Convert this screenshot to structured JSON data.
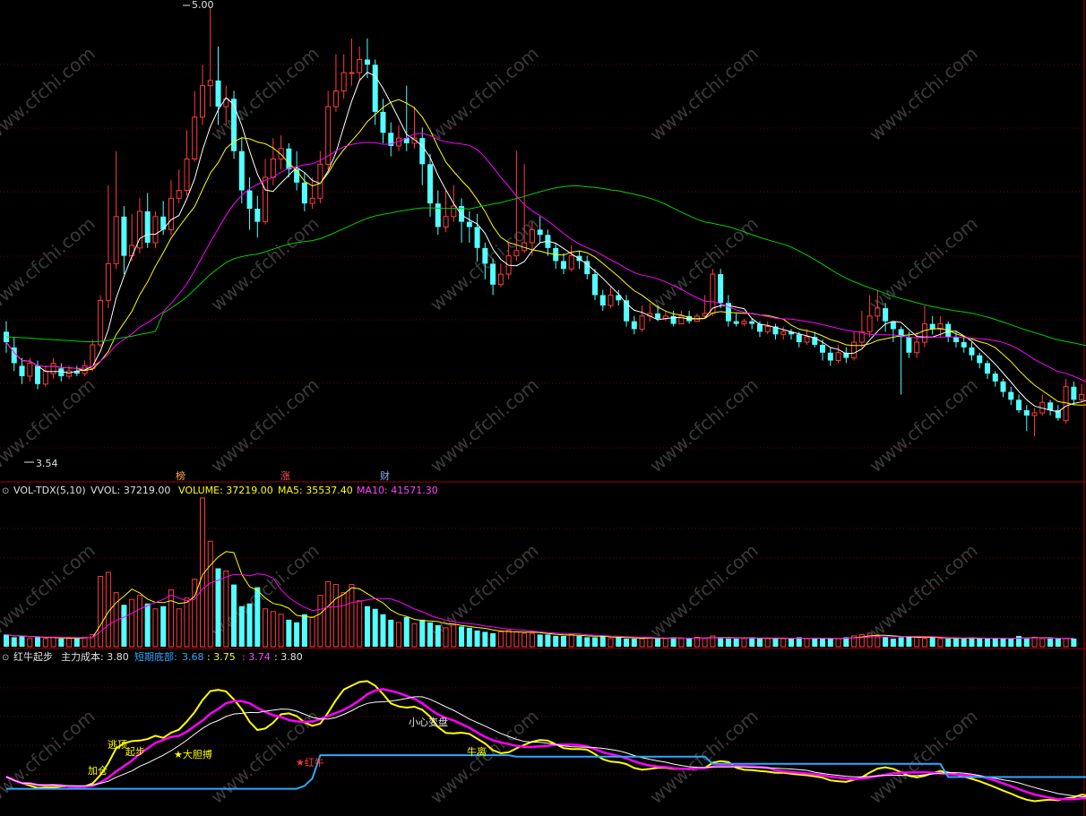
{
  "colors": {
    "bg": "#000000",
    "up": "#ff3b3b",
    "down": "#54ffff",
    "grid": "#7a0000",
    "sep": "#a00000",
    "ma_white": "#ffffff",
    "ma_yellow": "#ffff00",
    "ma_magenta": "#ff00ff",
    "ma_green": "#00d000",
    "cost_blue": "#2ea8ff",
    "label_white": "#e0e0e0",
    "wm": "#3a3a3a"
  },
  "price_panel": {
    "high_label": "5.00",
    "low_label": "3.54",
    "tags": [
      "榜",
      "涨",
      "财"
    ]
  },
  "volume_panel": {
    "indicator": "VOL-TDX(5,10)",
    "vvol": "VVOL: 37219.00",
    "volume": "VOLUME: 37219.00",
    "ma5": "MA5: 35537.40",
    "ma10": "MA10: 41571.30"
  },
  "indicator_panel": {
    "name": "红牛起步",
    "main_cost": "主力成本: 3.80",
    "short_bottom_label": "短期底部:",
    "v1": "3.68",
    "v2": ": 3.75",
    "v3": ": 3.74",
    "v4": ": 3.80",
    "annotations": [
      "逃顶",
      "起步",
      "★大胆搏",
      "★红牛",
      "加仓",
      "小心变盘",
      "牛离"
    ]
  },
  "watermark": "www.cfchi.com",
  "chart_data": {
    "type": "candlestick",
    "price_ylim": [
      3.2,
      5.0
    ],
    "candles": [
      [
        3.76,
        3.72,
        3.8,
        3.68
      ],
      [
        3.7,
        3.64,
        3.74,
        3.61
      ],
      [
        3.63,
        3.59,
        3.66,
        3.56
      ],
      [
        3.59,
        3.64,
        3.66,
        3.57
      ],
      [
        3.63,
        3.56,
        3.65,
        3.54
      ],
      [
        3.56,
        3.61,
        3.63,
        3.55
      ],
      [
        3.6,
        3.64,
        3.66,
        3.58
      ],
      [
        3.62,
        3.59,
        3.64,
        3.57
      ],
      [
        3.59,
        3.61,
        3.63,
        3.58
      ],
      [
        3.61,
        3.6,
        3.63,
        3.59
      ],
      [
        3.6,
        3.63,
        3.65,
        3.59
      ],
      [
        3.62,
        3.71,
        3.73,
        3.61
      ],
      [
        3.71,
        3.88,
        3.9,
        3.7
      ],
      [
        3.88,
        4.02,
        4.32,
        3.85
      ],
      [
        4.02,
        4.2,
        4.45,
        4.0
      ],
      [
        4.2,
        4.05,
        4.24,
        3.98
      ],
      [
        4.05,
        4.09,
        4.21,
        4.03
      ],
      [
        4.08,
        4.22,
        4.27,
        4.06
      ],
      [
        4.22,
        4.1,
        4.29,
        4.08
      ],
      [
        4.1,
        4.2,
        4.22,
        4.08
      ],
      [
        4.2,
        4.15,
        4.26,
        4.13
      ],
      [
        4.15,
        4.27,
        4.34,
        4.13
      ],
      [
        4.27,
        4.3,
        4.38,
        4.25
      ],
      [
        4.3,
        4.42,
        4.53,
        4.28
      ],
      [
        4.42,
        4.58,
        4.68,
        4.41
      ],
      [
        4.58,
        4.7,
        4.78,
        4.55
      ],
      [
        4.7,
        4.72,
        5.0,
        4.62
      ],
      [
        4.72,
        4.62,
        4.85,
        4.55
      ],
      [
        4.62,
        4.65,
        4.7,
        4.55
      ],
      [
        4.65,
        4.45,
        4.68,
        4.42
      ],
      [
        4.45,
        4.3,
        4.5,
        4.25
      ],
      [
        4.3,
        4.23,
        4.35,
        4.15
      ],
      [
        4.23,
        4.18,
        4.28,
        4.12
      ],
      [
        4.18,
        4.35,
        4.42,
        4.17
      ],
      [
        4.35,
        4.42,
        4.5,
        4.32
      ],
      [
        4.42,
        4.46,
        4.51,
        4.38
      ],
      [
        4.46,
        4.38,
        4.48,
        4.35
      ],
      [
        4.38,
        4.33,
        4.45,
        4.3
      ],
      [
        4.33,
        4.25,
        4.37,
        4.22
      ],
      [
        4.25,
        4.27,
        4.35,
        4.23
      ],
      [
        4.27,
        4.4,
        4.45,
        4.25
      ],
      [
        4.4,
        4.62,
        4.68,
        4.38
      ],
      [
        4.62,
        4.68,
        4.82,
        4.6
      ],
      [
        4.68,
        4.75,
        4.82,
        4.65
      ],
      [
        4.75,
        4.75,
        4.88,
        4.7
      ],
      [
        4.75,
        4.8,
        4.85,
        4.72
      ],
      [
        4.8,
        4.78,
        4.88,
        4.73
      ],
      [
        4.78,
        4.6,
        4.8,
        4.55
      ],
      [
        4.6,
        4.52,
        4.65,
        4.48
      ],
      [
        4.52,
        4.47,
        4.56,
        4.43
      ],
      [
        4.47,
        4.5,
        4.55,
        4.45
      ],
      [
        4.5,
        4.48,
        4.7,
        4.45
      ],
      [
        4.48,
        4.5,
        4.62,
        4.46
      ],
      [
        4.5,
        4.4,
        4.54,
        4.32
      ],
      [
        4.4,
        4.25,
        4.44,
        4.2
      ],
      [
        4.25,
        4.16,
        4.3,
        4.13
      ],
      [
        4.16,
        4.2,
        4.3,
        4.14
      ],
      [
        4.2,
        4.24,
        4.32,
        4.18
      ],
      [
        4.24,
        4.18,
        4.27,
        4.1
      ],
      [
        4.18,
        4.16,
        4.22,
        4.1
      ],
      [
        4.16,
        4.08,
        4.21,
        4.03
      ],
      [
        4.08,
        4.02,
        4.1,
        3.96
      ],
      [
        4.02,
        3.94,
        4.04,
        3.9
      ],
      [
        3.94,
        3.98,
        4.02,
        3.93
      ],
      [
        3.98,
        4.05,
        4.1,
        3.96
      ],
      [
        4.05,
        4.07,
        4.45,
        4.03
      ],
      [
        4.07,
        4.1,
        4.4,
        4.06
      ],
      [
        4.1,
        4.15,
        4.18,
        4.05
      ],
      [
        4.15,
        4.13,
        4.2,
        4.1
      ],
      [
        4.13,
        4.08,
        4.15,
        4.05
      ],
      [
        4.08,
        4.03,
        4.1,
        4.0
      ],
      [
        4.03,
        4.0,
        4.06,
        3.98
      ],
      [
        4.0,
        4.05,
        4.09,
        3.99
      ],
      [
        4.05,
        4.03,
        4.07,
        4.0
      ],
      [
        4.03,
        3.98,
        4.05,
        3.96
      ],
      [
        3.98,
        3.9,
        4.0,
        3.88
      ],
      [
        3.9,
        3.86,
        3.92,
        3.84
      ],
      [
        3.86,
        3.9,
        3.93,
        3.85
      ],
      [
        3.9,
        3.88,
        3.92,
        3.86
      ],
      [
        3.88,
        3.8,
        3.9,
        3.78
      ],
      [
        3.8,
        3.77,
        3.82,
        3.75
      ],
      [
        3.77,
        3.82,
        3.86,
        3.76
      ],
      [
        3.82,
        3.83,
        3.87,
        3.8
      ],
      [
        3.83,
        3.81,
        3.86,
        3.8
      ],
      [
        3.81,
        3.82,
        3.84,
        3.8
      ],
      [
        3.82,
        3.79,
        3.84,
        3.78
      ],
      [
        3.79,
        3.82,
        3.84,
        3.79
      ],
      [
        3.82,
        3.8,
        3.84,
        3.79
      ],
      [
        3.8,
        3.82,
        3.83,
        3.8
      ],
      [
        3.82,
        3.83,
        3.9,
        3.81
      ],
      [
        3.83,
        3.98,
        4.0,
        3.82
      ],
      [
        3.98,
        3.87,
        4.0,
        3.85
      ],
      [
        3.87,
        3.8,
        3.9,
        3.78
      ],
      [
        3.8,
        3.79,
        3.83,
        3.78
      ],
      [
        3.79,
        3.8,
        3.81,
        3.78
      ],
      [
        3.8,
        3.79,
        3.81,
        3.77
      ],
      [
        3.79,
        3.76,
        3.8,
        3.74
      ],
      [
        3.76,
        3.78,
        3.8,
        3.75
      ],
      [
        3.78,
        3.75,
        3.79,
        3.73
      ],
      [
        3.75,
        3.76,
        3.78,
        3.73
      ],
      [
        3.76,
        3.75,
        3.77,
        3.73
      ],
      [
        3.75,
        3.72,
        3.76,
        3.7
      ],
      [
        3.72,
        3.74,
        3.77,
        3.71
      ],
      [
        3.74,
        3.71,
        3.76,
        3.7
      ],
      [
        3.71,
        3.68,
        3.73,
        3.65
      ],
      [
        3.68,
        3.65,
        3.7,
        3.63
      ],
      [
        3.65,
        3.68,
        3.71,
        3.64
      ],
      [
        3.68,
        3.66,
        3.7,
        3.64
      ],
      [
        3.66,
        3.72,
        3.76,
        3.65
      ],
      [
        3.72,
        3.76,
        3.84,
        3.7
      ],
      [
        3.76,
        3.82,
        3.9,
        3.74
      ],
      [
        3.82,
        3.85,
        3.92,
        3.8
      ],
      [
        3.85,
        3.8,
        3.87,
        3.76
      ],
      [
        3.8,
        3.77,
        3.8,
        3.72
      ],
      [
        3.77,
        3.74,
        3.78,
        3.52
      ],
      [
        3.74,
        3.68,
        3.76,
        3.66
      ],
      [
        3.68,
        3.72,
        3.76,
        3.66
      ],
      [
        3.72,
        3.79,
        3.86,
        3.7
      ],
      [
        3.79,
        3.77,
        3.82,
        3.75
      ],
      [
        3.77,
        3.79,
        3.82,
        3.74
      ],
      [
        3.79,
        3.74,
        3.8,
        3.72
      ],
      [
        3.74,
        3.72,
        3.76,
        3.7
      ],
      [
        3.72,
        3.7,
        3.74,
        3.68
      ],
      [
        3.7,
        3.67,
        3.72,
        3.65
      ],
      [
        3.67,
        3.64,
        3.68,
        3.62
      ],
      [
        3.64,
        3.6,
        3.65,
        3.58
      ],
      [
        3.6,
        3.57,
        3.61,
        3.55
      ],
      [
        3.57,
        3.53,
        3.58,
        3.51
      ],
      [
        3.53,
        3.5,
        3.55,
        3.48
      ],
      [
        3.5,
        3.46,
        3.52,
        3.45
      ],
      [
        3.46,
        3.44,
        3.48,
        3.38
      ],
      [
        3.44,
        3.45,
        3.47,
        3.36
      ],
      [
        3.45,
        3.49,
        3.52,
        3.44
      ],
      [
        3.49,
        3.46,
        3.5,
        3.44
      ],
      [
        3.46,
        3.43,
        3.48,
        3.42
      ],
      [
        3.42,
        3.55,
        3.58,
        3.41
      ],
      [
        3.55,
        3.5,
        3.57,
        3.48
      ],
      [
        3.5,
        3.52,
        3.56,
        3.49
      ],
      [
        3.52,
        3.51,
        3.55,
        3.48
      ],
      [
        3.51,
        3.54,
        3.56,
        3.49
      ],
      [
        3.54,
        3.46,
        3.56,
        3.44
      ],
      [
        3.46,
        3.42,
        3.48,
        3.4
      ]
    ],
    "volume": [
      9,
      7,
      8,
      6,
      7,
      6,
      7,
      6,
      6,
      6,
      7,
      9,
      52,
      55,
      40,
      31,
      35,
      38,
      32,
      28,
      30,
      42,
      28,
      36,
      50,
      110,
      78,
      58,
      56,
      46,
      30,
      32,
      44,
      28,
      26,
      24,
      20,
      18,
      24,
      22,
      38,
      48,
      46,
      40,
      46,
      34,
      30,
      28,
      24,
      20,
      18,
      22,
      17,
      20,
      18,
      16,
      14,
      16,
      15,
      14,
      12,
      11,
      10,
      11,
      12,
      11,
      10,
      10,
      9,
      9,
      8,
      8,
      9,
      8,
      7,
      7,
      8,
      6,
      7,
      6,
      6,
      6,
      7,
      6,
      6,
      7,
      6,
      6,
      7,
      6,
      8,
      7,
      6,
      6,
      6,
      7,
      6,
      6,
      6,
      6,
      6,
      7,
      6,
      6,
      6,
      6,
      6,
      7,
      8,
      9,
      10,
      8,
      7,
      6,
      7,
      8,
      7,
      6,
      7,
      6,
      6,
      6,
      6,
      7,
      6,
      6,
      6,
      6,
      6,
      8,
      6,
      7,
      6,
      6,
      6,
      6,
      6
    ]
  }
}
